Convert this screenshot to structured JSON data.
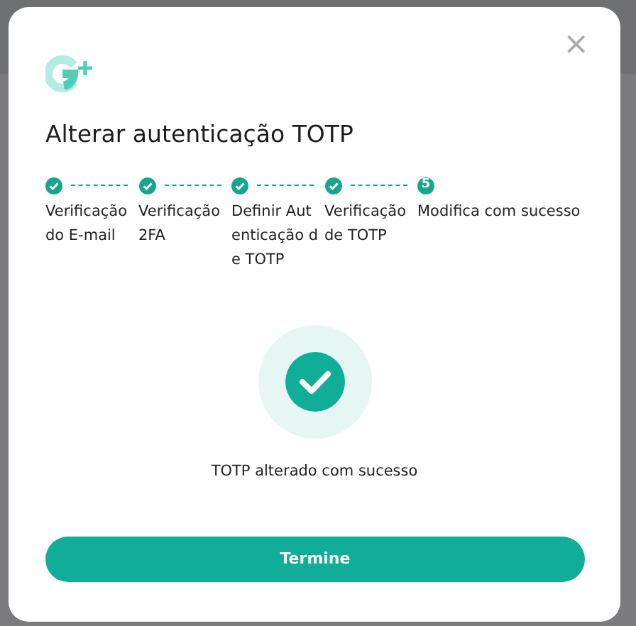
{
  "dialog": {
    "title": "Alterar autenticação TOTP",
    "close_label": "×"
  },
  "steps": [
    {
      "label": "Verificação do E-mail",
      "completed": true
    },
    {
      "label": "Verificação 2FA",
      "completed": true
    },
    {
      "label": "Definir Autenticação de TOTP",
      "completed": true
    },
    {
      "label": "Verificação de TOTP",
      "completed": true
    },
    {
      "label": "Modifica com sucesso",
      "completed": false,
      "number": "5"
    }
  ],
  "result": {
    "message": "TOTP alterado com sucesso"
  },
  "buttons": [
    {
      "label": "Termine"
    }
  ]
}
